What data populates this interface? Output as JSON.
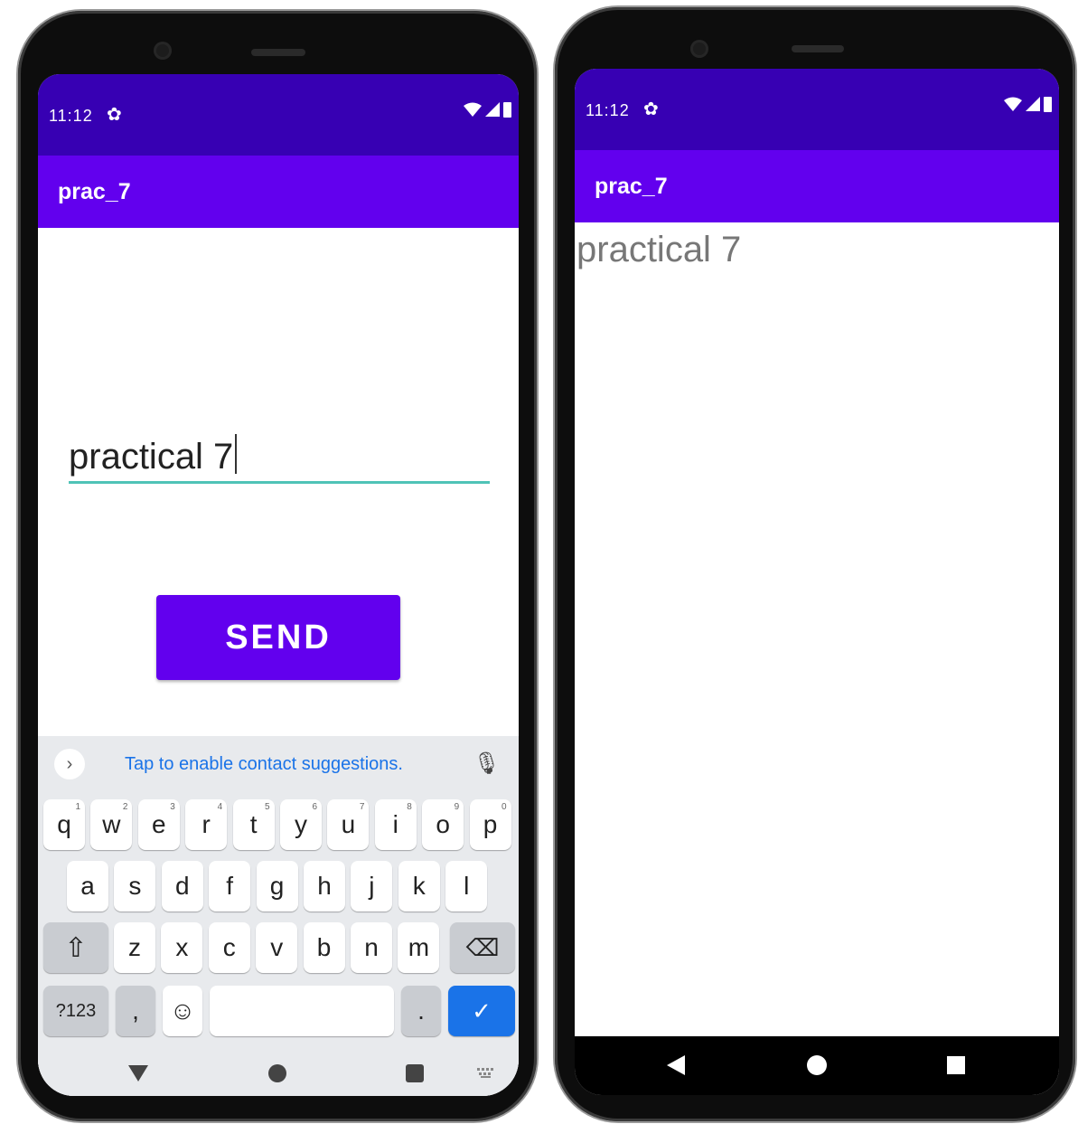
{
  "colors": {
    "status_bar": "#3700b3",
    "app_bar": "#6200ee",
    "button": "#6200ee",
    "edit_underline": "#4fc3b7",
    "suggestion_text": "#1a73e8",
    "enter_key": "#1a73e8"
  },
  "left_phone": {
    "status": {
      "time": "11:12",
      "icons": [
        "gear-icon",
        "wifi-icon",
        "signal-icon",
        "battery-icon"
      ]
    },
    "app_bar": {
      "title": "prac_7"
    },
    "edit_text": {
      "value": "practical 7"
    },
    "send_button": {
      "label": "SEND"
    },
    "keyboard": {
      "suggestion": "Tap to enable contact suggestions.",
      "row1": [
        {
          "k": "q",
          "h": "1"
        },
        {
          "k": "w",
          "h": "2"
        },
        {
          "k": "e",
          "h": "3"
        },
        {
          "k": "r",
          "h": "4"
        },
        {
          "k": "t",
          "h": "5"
        },
        {
          "k": "y",
          "h": "6"
        },
        {
          "k": "u",
          "h": "7"
        },
        {
          "k": "i",
          "h": "8"
        },
        {
          "k": "o",
          "h": "9"
        },
        {
          "k": "p",
          "h": "0"
        }
      ],
      "row2": [
        "a",
        "s",
        "d",
        "f",
        "g",
        "h",
        "j",
        "k",
        "l"
      ],
      "row3": [
        "z",
        "x",
        "c",
        "v",
        "b",
        "n",
        "m"
      ],
      "symbols_label": "?123",
      "comma_label": ",",
      "period_label": "."
    }
  },
  "right_phone": {
    "status": {
      "time": "11:12"
    },
    "app_bar": {
      "title": "prac_7"
    },
    "result_text": "practical 7"
  }
}
